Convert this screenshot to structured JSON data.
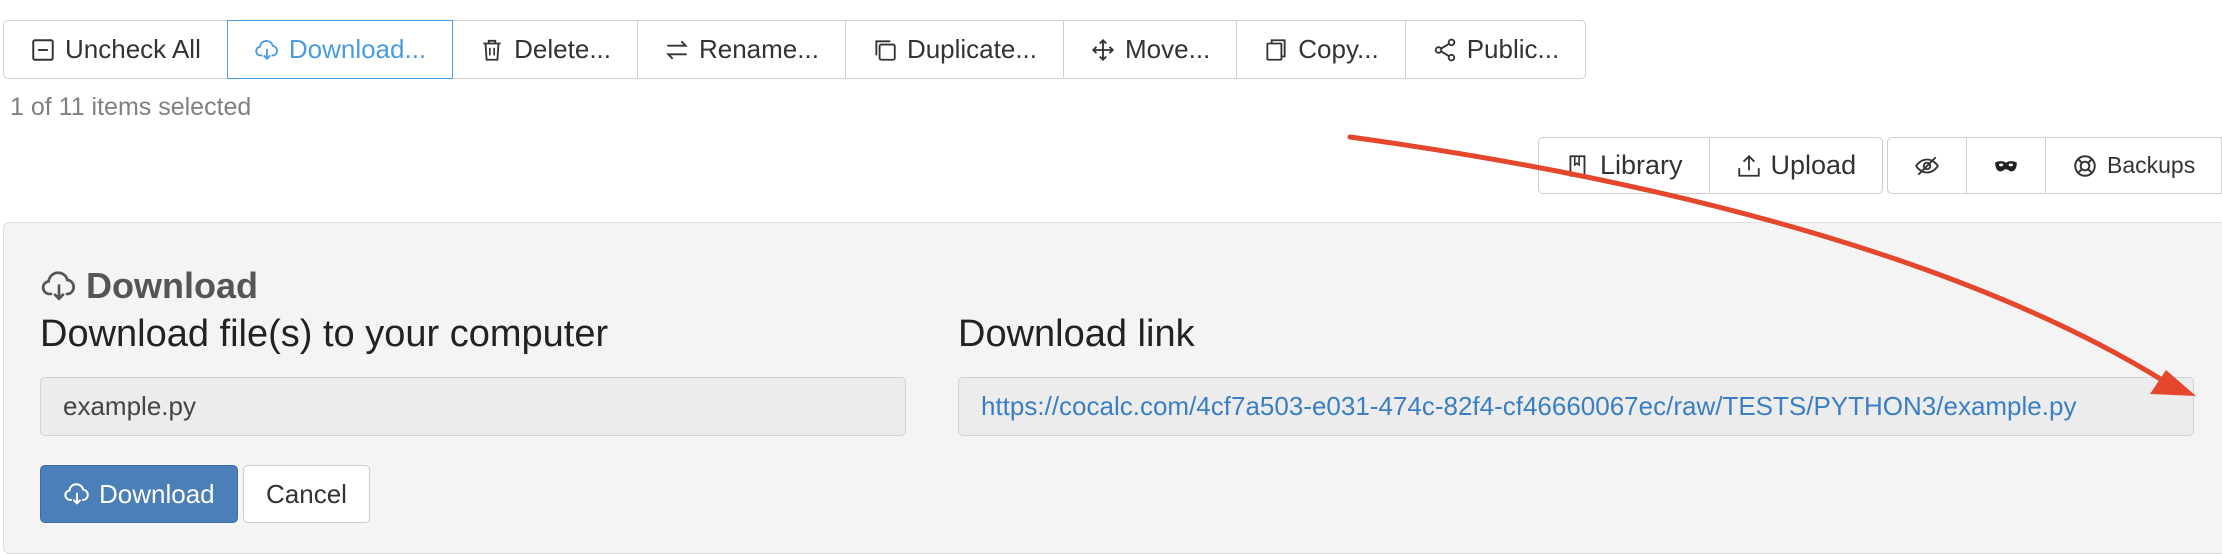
{
  "toolbar": {
    "uncheck_all": "Uncheck All",
    "download": "Download...",
    "delete": "Delete...",
    "rename": "Rename...",
    "duplicate": "Duplicate...",
    "move": "Move...",
    "copy": "Copy...",
    "public": "Public..."
  },
  "selection": {
    "status": "1 of 11 items selected"
  },
  "right_toolbar": {
    "library": "Library",
    "upload": "Upload",
    "hidden_files_icon": "eye-slash-icon",
    "mask_icon": "mask-icon",
    "backups": "Backups"
  },
  "panel": {
    "title": "Download",
    "left_heading": "Download file(s) to your computer",
    "filename": "example.py",
    "right_heading": "Download link",
    "link": "https://cocalc.com/4cf7a503-e031-474c-82f4-cf46660067ec/raw/TESTS/PYTHON3/example.py",
    "download_button": "Download",
    "cancel_button": "Cancel"
  },
  "colors": {
    "accent": "#4a9be0",
    "primary_button": "#4a7fb8",
    "link": "#3a7fc4",
    "annotation_arrow": "#e4472c"
  }
}
